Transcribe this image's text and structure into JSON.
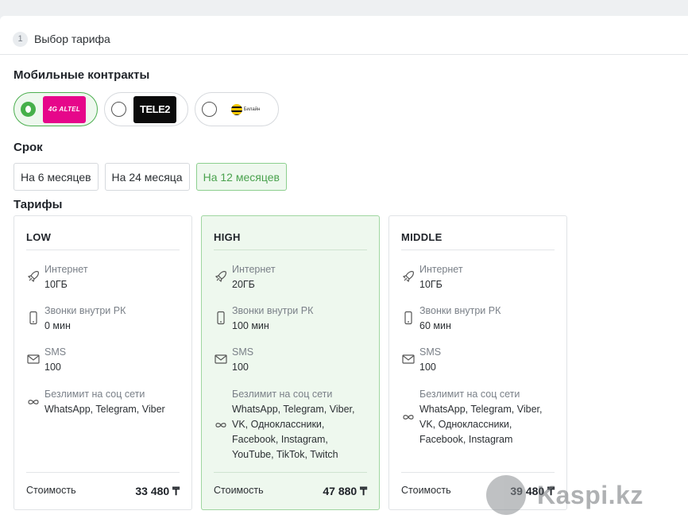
{
  "step": {
    "number": "1",
    "label": "Выбор тарифа"
  },
  "operators_section": {
    "title": "Мобильные контракты",
    "items": [
      {
        "name": "4G ALTEL",
        "selected": true,
        "logo_color": "#e6078a"
      },
      {
        "name": "TELE2",
        "selected": false,
        "logo_color": "#0b0b0b"
      },
      {
        "name": "Билайн",
        "selected": false,
        "logo_color": "#f7c600"
      }
    ]
  },
  "term_section": {
    "title": "Срок",
    "options": [
      {
        "label": "На 6 месяцев",
        "active": false
      },
      {
        "label": "На 24 месяца",
        "active": false
      },
      {
        "label": "На 12 месяцев",
        "active": true
      }
    ]
  },
  "plans_section": {
    "title": "Тарифы",
    "cost_label": "Стоимость",
    "plans": [
      {
        "name": "LOW",
        "featured": false,
        "internet_label": "Интернет",
        "internet": "10ГБ",
        "calls_label": "Звонки внутри РК",
        "calls": "0 мин",
        "sms_label": "SMS",
        "sms": "100",
        "social_label": "Безлимит на соц сети",
        "social_lines": [
          "WhatsApp, Telegram, Viber"
        ],
        "price": "33 480 ₸"
      },
      {
        "name": "HIGH",
        "featured": true,
        "internet_label": "Интернет",
        "internet": "20ГБ",
        "calls_label": "Звонки внутри РК",
        "calls": "100 мин",
        "sms_label": "SMS",
        "sms": "100",
        "social_label": "Безлимит на соц сети",
        "social_lines": [
          "WhatsApp, Telegram, Viber,",
          "VK, Одноклассники,",
          "Facebook, Instagram,",
          "YouTube, TikTok, Twitch"
        ],
        "price": "47 880 ₸"
      },
      {
        "name": "MIDDLE",
        "featured": false,
        "internet_label": "Интернет",
        "internet": "10ГБ",
        "calls_label": "Звонки внутри РК",
        "calls": "60 мин",
        "sms_label": "SMS",
        "sms": "100",
        "social_label": "Безлимит на соц сети",
        "social_lines": [
          "WhatsApp, Telegram, Viber,",
          "VK, Одноклассники,",
          "Facebook, Instagram"
        ],
        "price": "39 480 ₸"
      }
    ]
  },
  "watermark": {
    "text": "Kaspi.kz"
  },
  "colors": {
    "accent": "#46b04a",
    "featured_bg": "#eef8ee"
  }
}
